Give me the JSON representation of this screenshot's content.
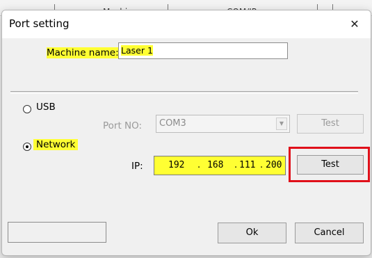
{
  "background": {
    "columns": [
      "Machine",
      "COM/IP"
    ]
  },
  "dialog": {
    "title": "Port setting",
    "close_glyph": "✕",
    "machine_name_label": "Machine name:",
    "machine_name_value": "Laser 1",
    "usb": {
      "label": "USB",
      "selected": false,
      "port_no_label": "Port NO:",
      "port_value": "COM3",
      "test_label": "Test"
    },
    "network": {
      "label": "Network",
      "selected": true,
      "ip_label": "IP:",
      "ip_parts": [
        "192",
        "168",
        "111",
        "200"
      ],
      "ip_separator": ".",
      "test_label": "Test"
    },
    "status_text": "",
    "ok_label": "Ok",
    "cancel_label": "Cancel"
  },
  "colors": {
    "highlight": "#ffff33",
    "callout_border": "#e0101a"
  },
  "icons": {
    "close": "close-icon",
    "dropdown": "chevron-down-icon"
  }
}
